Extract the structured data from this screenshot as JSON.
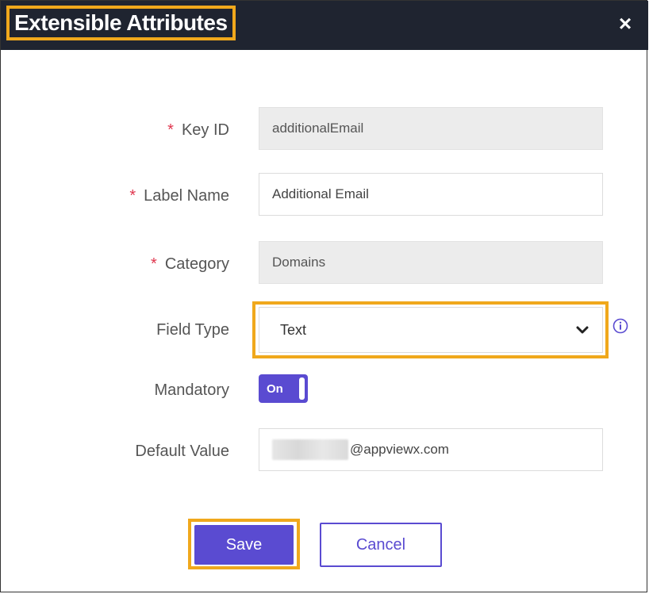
{
  "dialog": {
    "title": "Extensible Attributes",
    "close_glyph": "×"
  },
  "form": {
    "key_id": {
      "required_mark": "*",
      "label": "Key ID",
      "value": "additionalEmail",
      "disabled": true
    },
    "label_name": {
      "required_mark": "*",
      "label": "Label Name",
      "value": "Additional Email"
    },
    "category": {
      "required_mark": "*",
      "label": "Category",
      "value": "Domains",
      "disabled": true
    },
    "field_type": {
      "label": "Field Type",
      "value": "Text",
      "info_icon": "info-icon"
    },
    "mandatory": {
      "label": "Mandatory",
      "toggle_label": "On",
      "state": true
    },
    "default_value": {
      "label": "Default Value",
      "value_visible": "@appviewx.com"
    }
  },
  "actions": {
    "save_label": "Save",
    "cancel_label": "Cancel"
  },
  "colors": {
    "header_bg": "#1f2430",
    "highlight": "#f0a81c",
    "accent": "#5a4bd1",
    "required": "#e0364e",
    "disabled_bg": "#ececec"
  }
}
